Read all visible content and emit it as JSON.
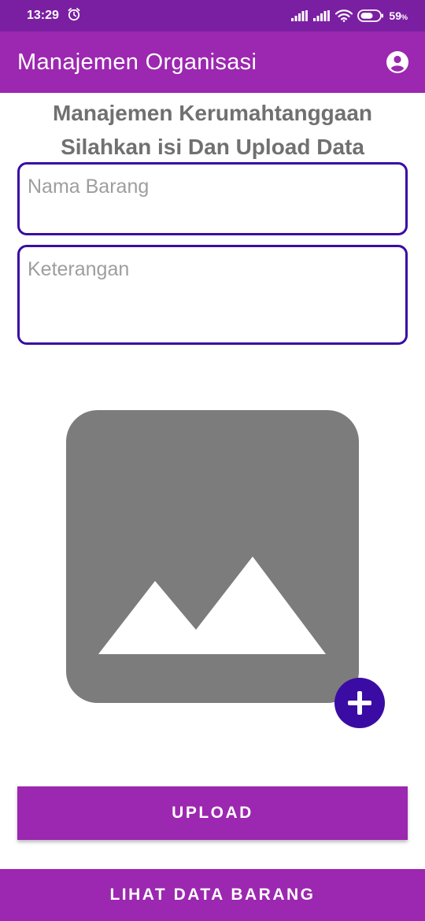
{
  "status_bar": {
    "time": "13:29",
    "battery": "59",
    "battery_unit": "%",
    "icons": [
      "alarm-icon",
      "signal-icon",
      "signal-icon",
      "wifi-icon",
      "battery-icon"
    ]
  },
  "app_bar": {
    "title": "Manajemen Organisasi",
    "account_icon": "account-circle-icon"
  },
  "heading": {
    "line1": "Manajemen Kerumahtanggaan",
    "line2": "Silahkan isi Dan Upload Data"
  },
  "form": {
    "nama_barang": {
      "value": "",
      "placeholder": "Nama Barang"
    },
    "keterangan": {
      "value": "",
      "placeholder": "Keterangan"
    }
  },
  "image_picker": {
    "placeholder_icon": "image-placeholder-icon",
    "add_icon": "plus-icon"
  },
  "buttons": {
    "upload": "UPLOAD",
    "lihat_data": "LIHAT DATA BARANG"
  },
  "colors": {
    "status_bar": "#7b1fa2",
    "primary": "#9c27b0",
    "accent": "#3a0ca3",
    "placeholder_image": "#7c7c7c"
  }
}
